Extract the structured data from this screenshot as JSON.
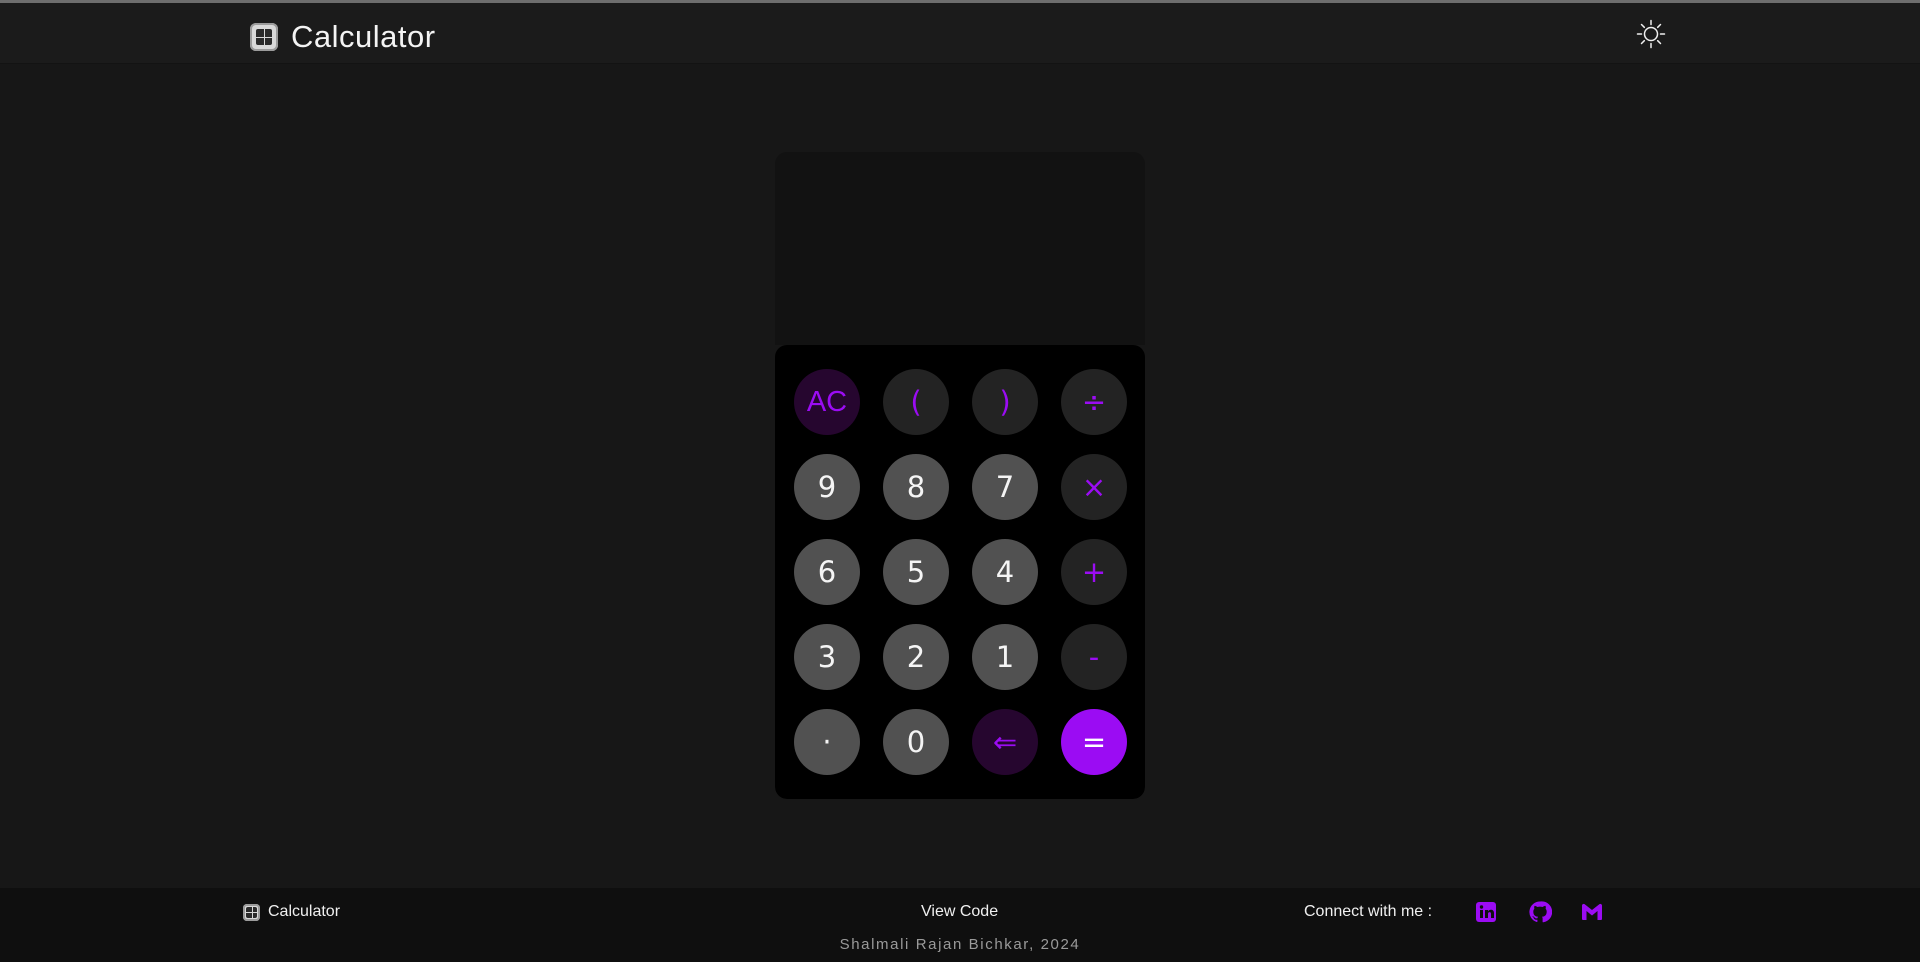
{
  "header": {
    "title": "Calculator",
    "theme_toggle_icon": "sun-icon"
  },
  "calculator": {
    "display": "",
    "keys": [
      {
        "label": "AC",
        "kind": "clear"
      },
      {
        "label": "(",
        "kind": "operator"
      },
      {
        "label": ")",
        "kind": "operator"
      },
      {
        "label": "÷",
        "kind": "operator"
      },
      {
        "label": "9",
        "kind": "digit"
      },
      {
        "label": "8",
        "kind": "digit"
      },
      {
        "label": "7",
        "kind": "digit"
      },
      {
        "label": "×",
        "kind": "operator"
      },
      {
        "label": "6",
        "kind": "digit"
      },
      {
        "label": "5",
        "kind": "digit"
      },
      {
        "label": "4",
        "kind": "digit"
      },
      {
        "label": "+",
        "kind": "operator"
      },
      {
        "label": "3",
        "kind": "digit"
      },
      {
        "label": "2",
        "kind": "digit"
      },
      {
        "label": "1",
        "kind": "digit"
      },
      {
        "label": "-",
        "kind": "operator"
      },
      {
        "label": "·",
        "kind": "digit"
      },
      {
        "label": "0",
        "kind": "digit"
      },
      {
        "label": "⇐",
        "kind": "backspace"
      },
      {
        "label": "=",
        "kind": "equals"
      }
    ]
  },
  "footer": {
    "brand_label": "Calculator",
    "view_code": "View Code",
    "connect_label": "Connect with me :",
    "social_icons": [
      "linkedin-icon",
      "github-icon",
      "gmail-icon"
    ],
    "credit": "Shalmali Rajan Bichkar, 2024"
  },
  "colors": {
    "accent": "#9b0cf3",
    "background": "#171717",
    "digit_key": "#515151",
    "operator_key": "#232323"
  }
}
